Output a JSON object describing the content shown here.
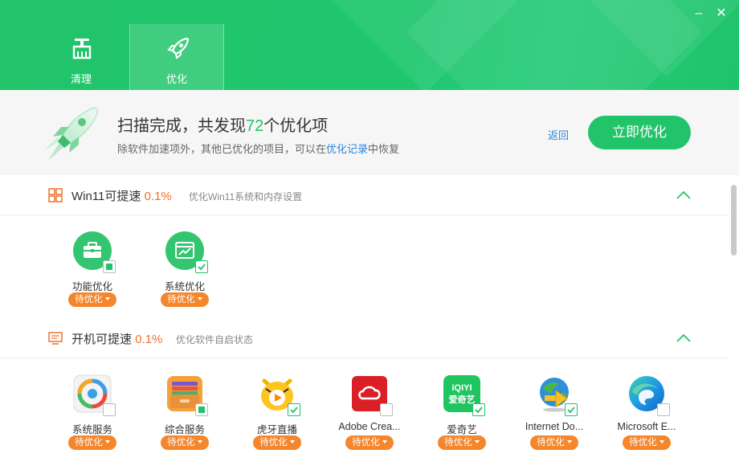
{
  "nav": {
    "tabs": [
      {
        "label": "清理",
        "icon": "broom-icon"
      },
      {
        "label": "优化",
        "icon": "rocket-icon"
      }
    ],
    "active": "优化",
    "window_buttons": {
      "minimize": "–",
      "close": "✕"
    }
  },
  "summary": {
    "title_prefix": "扫描完成，共发现",
    "count": "72",
    "title_suffix": "个优化项",
    "desc_prefix": "除软件加速项外，其他已优化的项目，可以在",
    "desc_link": "优化记录",
    "desc_suffix": "中恢复",
    "back_label": "返回",
    "optimize_label": "立即优化"
  },
  "sections": [
    {
      "title": "Win11可提速",
      "percent": "0.1%",
      "desc": "优化Win11系统和内存设置",
      "items": [
        {
          "name": "功能优化",
          "status": "待优化",
          "icon": "toolbox-icon",
          "check": "partial"
        },
        {
          "name": "系统优化",
          "status": "待优化",
          "icon": "system-chart-icon",
          "check": "checked"
        }
      ]
    },
    {
      "title": "开机可提速",
      "percent": "0.1%",
      "desc": "优化软件自启状态",
      "items": [
        {
          "name": "系统服务",
          "status": "待优化",
          "icon": "system-service-icon",
          "check": "unchecked"
        },
        {
          "name": "综合服务",
          "status": "待优化",
          "icon": "wallet-icon",
          "check": "partial"
        },
        {
          "name": "虎牙直播",
          "status": "待优化",
          "icon": "huya-icon",
          "check": "checked"
        },
        {
          "name": "Adobe Crea...",
          "status": "待优化",
          "icon": "adobe-cc-icon",
          "check": "unchecked"
        },
        {
          "name": "爱奇艺",
          "status": "待优化",
          "icon": "iqiyi-icon",
          "check": "checked",
          "icon_text_top": "iQIYI",
          "icon_text_bottom": "爱奇艺"
        },
        {
          "name": "Internet Do...",
          "status": "待优化",
          "icon": "idm-icon",
          "check": "checked"
        },
        {
          "name": "Microsoft E...",
          "status": "待优化",
          "icon": "edge-icon",
          "check": "unchecked"
        }
      ]
    }
  ],
  "colors": {
    "brand_green": "#22c46a",
    "accent_orange": "#f5862c",
    "link_blue": "#2a86d6"
  }
}
